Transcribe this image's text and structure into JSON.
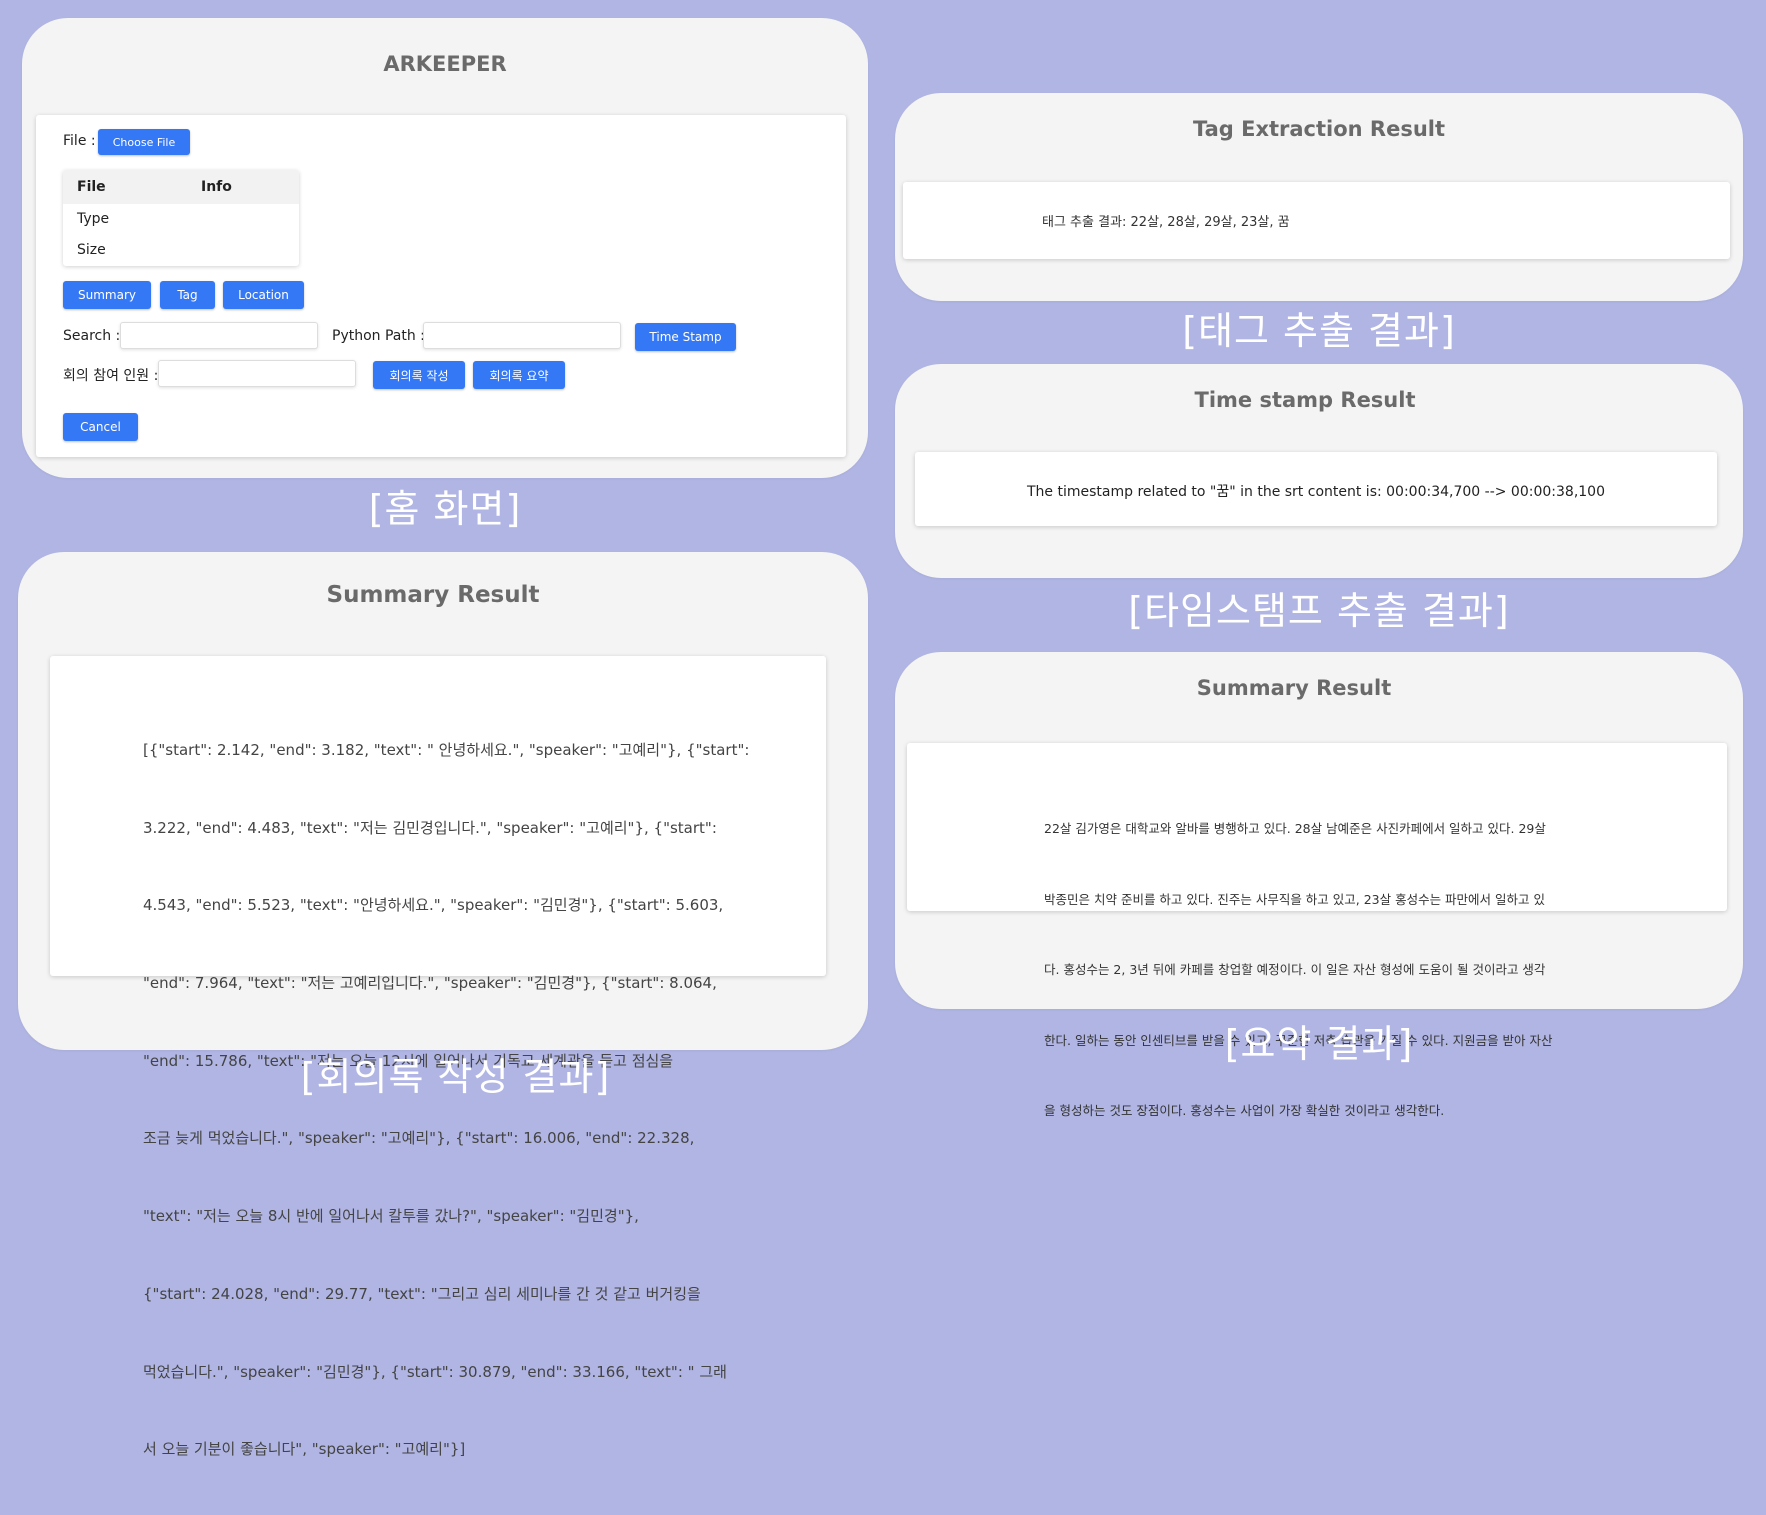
{
  "home": {
    "app_title": "ARKEEPER",
    "file_label": "File :",
    "choose_file_button": "Choose File",
    "table": {
      "headers": [
        "File",
        "Info"
      ],
      "rows": [
        "Type",
        "Size"
      ]
    },
    "buttons": {
      "summary": "Summary",
      "tag": "Tag",
      "location": "Location",
      "time_stamp": "Time Stamp",
      "minutes_write": "회의록 작성",
      "minutes_summary": "회의록 요약",
      "cancel": "Cancel"
    },
    "search_label": "Search :",
    "search_value": "",
    "python_path_label": "Python Path :",
    "python_path_value": "",
    "participants_label": "회의 참여 인원 :",
    "participants_value": "",
    "caption": "[홈 화면]"
  },
  "tag_panel": {
    "title": "Tag Extraction Result",
    "result_text": "태그 추출 결과: 22살, 28살, 29살, 23살, 꿈",
    "caption": "[태그 추출 결과]"
  },
  "timestamp_panel": {
    "title": "Time stamp Result",
    "result_text": "The timestamp related to \"꿈\" in the srt content is: 00:00:34,700 --> 00:00:38,100",
    "caption": "[타임스탬프 추출 결과]"
  },
  "minutes_panel": {
    "title": "Summary Result",
    "lines": [
      "[{\"start\": 2.142, \"end\": 3.182, \"text\": \" 안녕하세요.\", \"speaker\": \"고예리\"}, {\"start\":",
      "3.222, \"end\": 4.483, \"text\": \"저는 김민경입니다.\", \"speaker\": \"고예리\"}, {\"start\":",
      "4.543, \"end\": 5.523, \"text\": \"안녕하세요.\", \"speaker\": \"김민경\"}, {\"start\": 5.603,",
      "\"end\": 7.964, \"text\": \"저는 고예리입니다.\", \"speaker\": \"김민경\"}, {\"start\": 8.064,",
      "\"end\": 15.786, \"text\": \"저는 오늘 12시에 일어나서 기독교 세계관을 듣고 점심을",
      "조금 늦게 먹었습니다.\", \"speaker\": \"고예리\"}, {\"start\": 16.006, \"end\": 22.328,",
      "\"text\": \"저는 오늘 8시 반에 일어나서 칼투를 갔나?\", \"speaker\": \"김민경\"},",
      "{\"start\": 24.028, \"end\": 29.77, \"text\": \"그리고 심리 세미나를 간 것 같고 버거킹을",
      "먹었습니다.\", \"speaker\": \"김민경\"}, {\"start\": 30.879, \"end\": 33.166, \"text\": \" 그래",
      "서 오늘 기분이 좋습니다\", \"speaker\": \"고예리\"}]"
    ],
    "caption": "[회의록 작성 결과]"
  },
  "summary_panel": {
    "title": "Summary Result",
    "lines": [
      "22살 김가영은 대학교와 알바를 병행하고 있다. 28살 남예준은 사진카페에서 일하고 있다. 29살",
      "박종민은 치약 준비를 하고 있다. 진주는 사무직을 하고 있고, 23살 홍성수는 파만에서 일하고 있",
      "다. 홍성수는 2, 3년 뒤에 카페를 창업할 예정이다. 이 일은 자산 형성에 도움이 될 것이라고 생각",
      "한다. 일하는 동안 인센티브를 받을 수 있고, 꾸준한 저축 습관을 가질 수 있다. 지원금을 받아 자산",
      "을 형성하는 것도 장점이다. 홍성수는 사업이 가장 확실한 것이라고 생각한다."
    ],
    "caption": "[요약 결과]"
  }
}
